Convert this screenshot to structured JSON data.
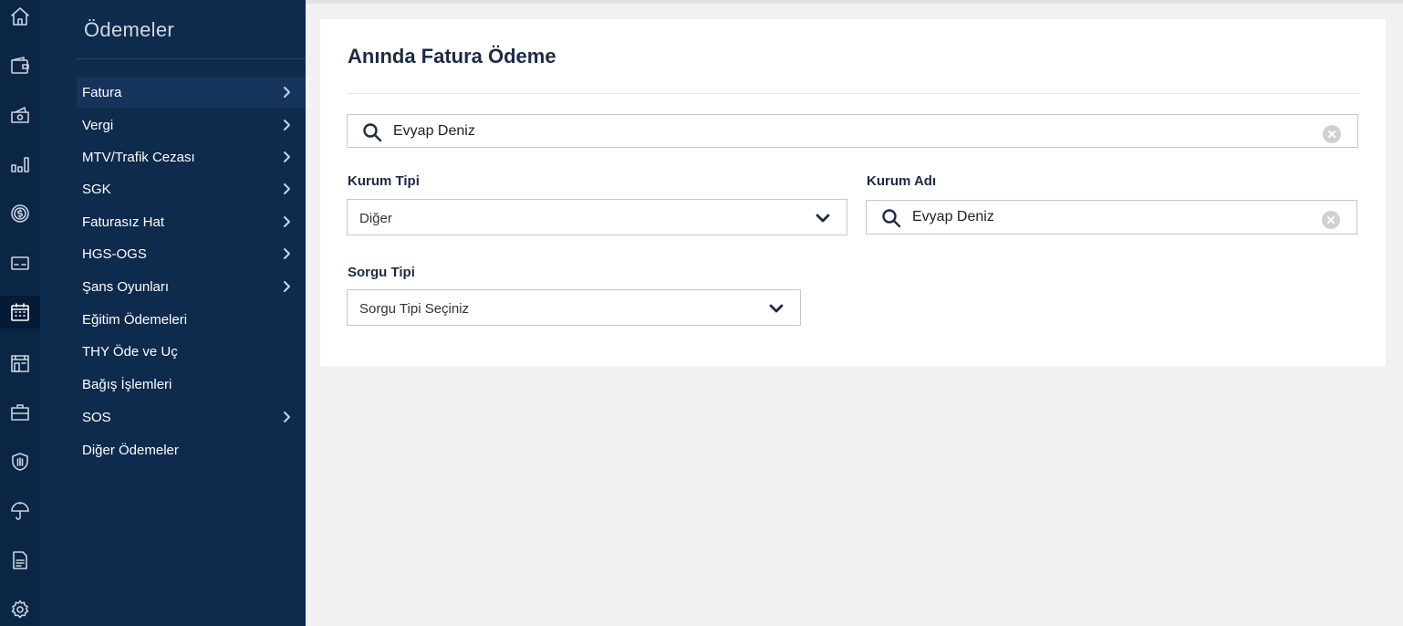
{
  "rail": {
    "icons": [
      "home-icon",
      "wallet-icon",
      "money-hand-icon",
      "bar-chart-icon",
      "coin-icon",
      "card-icon",
      "calendar-icon",
      "building-icon",
      "briefcase-icon",
      "shield-icon",
      "umbrella-icon",
      "document-icon",
      "gear-icon"
    ],
    "active": "calendar-icon"
  },
  "submenu": {
    "title": "Ödemeler",
    "items": [
      {
        "label": "Fatura",
        "has_arrow": true,
        "active": true
      },
      {
        "label": "Vergi",
        "has_arrow": true
      },
      {
        "label": "MTV/Trafik Cezası",
        "has_arrow": true
      },
      {
        "label": "SGK",
        "has_arrow": true
      },
      {
        "label": "Faturasız Hat",
        "has_arrow": true
      },
      {
        "label": "HGS-OGS",
        "has_arrow": true
      },
      {
        "label": "Şans Oyunları",
        "has_arrow": true
      },
      {
        "label": "Eğitim Ödemeleri",
        "has_arrow": false
      },
      {
        "label": "THY Öde ve Uç",
        "has_arrow": false
      },
      {
        "label": "Bağış İşlemleri",
        "has_arrow": false
      },
      {
        "label": "SOS",
        "has_arrow": true
      },
      {
        "label": "Diğer Ödemeler",
        "has_arrow": false
      }
    ]
  },
  "main": {
    "title": "Anında Fatura Ödeme",
    "search": {
      "value": "Evyap Deniz"
    },
    "kurum_tipi": {
      "label": "Kurum Tipi",
      "value": "Diğer"
    },
    "kurum_adi": {
      "label": "Kurum Adı",
      "value": "Evyap Deniz"
    },
    "sorgu_tipi": {
      "label": "Sorgu Tipi",
      "value": "Sorgu Tipi Seçiniz"
    }
  },
  "colors": {
    "rail_bg": "#0b2545",
    "submenu_bg": "#0e2a4d",
    "accent_text": "#1c2b45"
  }
}
